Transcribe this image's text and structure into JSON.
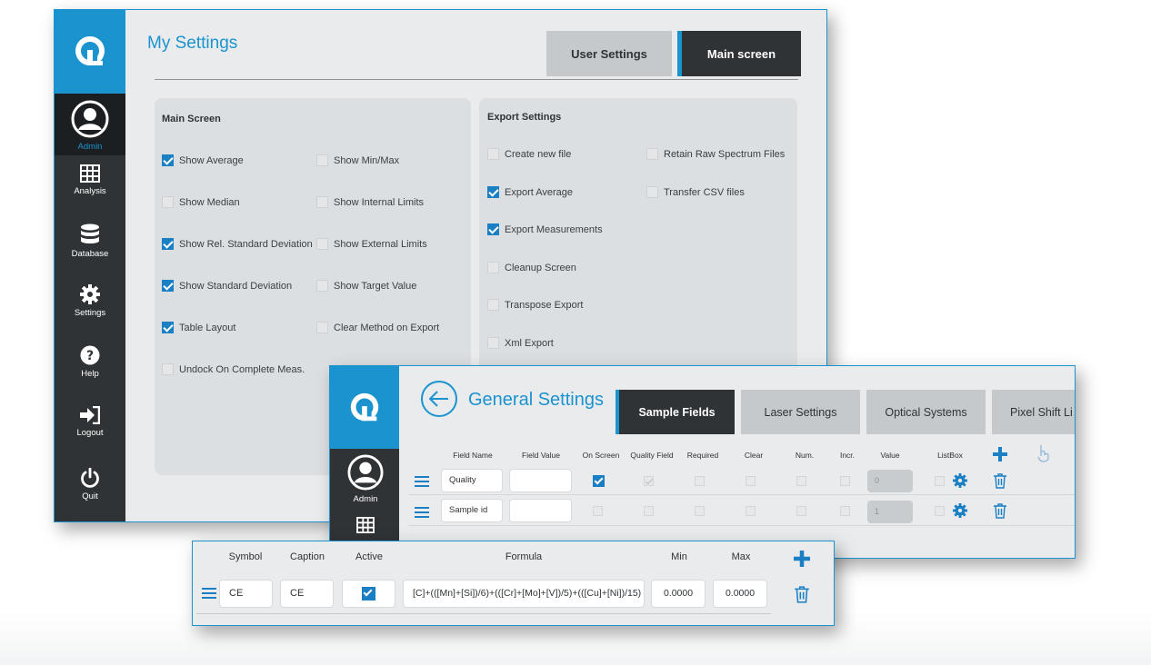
{
  "colors": {
    "accent": "#1b93cf",
    "sidebar": "#2f3336",
    "panel": "#dcdfe2"
  },
  "my_settings": {
    "title": "My Settings",
    "tabs": [
      {
        "label": "User Settings",
        "active": false
      },
      {
        "label": "Main screen",
        "active": true
      }
    ],
    "sidebar": [
      {
        "label": "Admin",
        "icon": "avatar-icon",
        "active": true
      },
      {
        "label": "Analysis",
        "icon": "grid-icon"
      },
      {
        "label": "Database",
        "icon": "database-icon"
      },
      {
        "label": "Settings",
        "icon": "gear-icon"
      },
      {
        "label": "Help",
        "icon": "help-icon"
      },
      {
        "label": "Logout",
        "icon": "logout-icon"
      },
      {
        "label": "Quit",
        "icon": "power-icon"
      }
    ],
    "main_screen": {
      "title": "Main Screen",
      "options": [
        {
          "label": "Show Average",
          "checked": true
        },
        {
          "label": "Show Min/Max",
          "checked": false
        },
        {
          "label": "Show Median",
          "checked": false
        },
        {
          "label": "Show Internal Limits",
          "checked": false
        },
        {
          "label": "Show Rel. Standard Deviation",
          "checked": true
        },
        {
          "label": "Show External Limits",
          "checked": false
        },
        {
          "label": "Show Standard Deviation",
          "checked": true
        },
        {
          "label": "Show Target Value",
          "checked": false
        },
        {
          "label": "Table Layout",
          "checked": true
        },
        {
          "label": "Clear Method on Export",
          "checked": false
        },
        {
          "label": "Undock On Complete Meas.",
          "checked": false
        }
      ]
    },
    "export_settings": {
      "title": "Export Settings",
      "options": [
        {
          "label": "Create new file",
          "checked": false
        },
        {
          "label": "Retain Raw Spectrum Files",
          "checked": false
        },
        {
          "label": "Export Average",
          "checked": true
        },
        {
          "label": "Transfer CSV files",
          "checked": false
        },
        {
          "label": "Export Measurements",
          "checked": true
        },
        {
          "label": "Cleanup Screen",
          "checked": false
        },
        {
          "label": "Transpose Export",
          "checked": false
        },
        {
          "label": "Xml Export",
          "checked": false
        }
      ]
    }
  },
  "general_settings": {
    "title": "General Settings",
    "sidebar": [
      {
        "label": "Admin"
      }
    ],
    "tabs": [
      {
        "label": "Sample Fields",
        "active": true
      },
      {
        "label": "Laser Settings"
      },
      {
        "label": "Optical Systems"
      },
      {
        "label": "Pixel Shift Li"
      }
    ],
    "columns": [
      "Field Name",
      "Field Value",
      "On Screen",
      "Quality Field",
      "Required",
      "Clear",
      "Num.",
      "Incr.",
      "Value",
      "ListBox"
    ],
    "rows": [
      {
        "field_name": "Quality",
        "field_value": "",
        "on_screen": true,
        "quality_field": true,
        "value": "0"
      },
      {
        "field_name": "Sample id",
        "field_value": "",
        "on_screen": false,
        "quality_field": false,
        "value": "1"
      }
    ]
  },
  "formula_table": {
    "columns": [
      "Symbol",
      "Caption",
      "Active",
      "Formula",
      "Min",
      "Max"
    ],
    "rows": [
      {
        "symbol": "CE",
        "caption": "CE",
        "active": true,
        "formula": "[C]+(([Mn]+[Si])/6)+(([Cr]+[Mo]+[V])/5)+(([Cu]+[Ni])/15)",
        "min": "0.0000",
        "max": "0.0000"
      }
    ]
  }
}
